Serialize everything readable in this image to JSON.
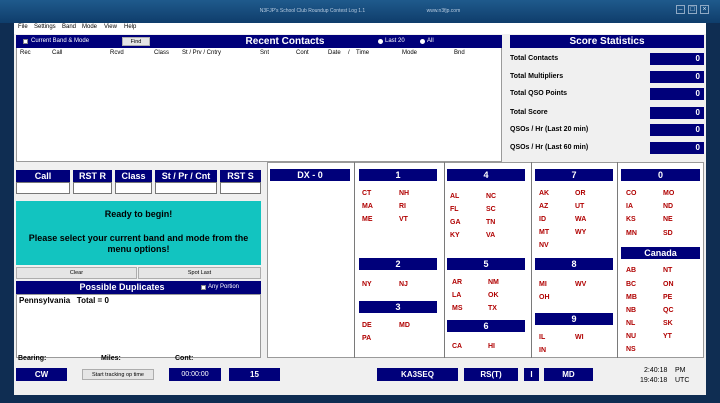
{
  "window": {
    "title": "N3FJP's School Club Roundup Contest Log 1.1",
    "url": "www.n3fjp.com"
  },
  "menu": [
    "File",
    "Settings",
    "Band",
    "Mode",
    "View",
    "Help"
  ],
  "recent": {
    "checkbox_label": "Current Band & Mode",
    "find_label": "Find",
    "title": "Recent Contacts",
    "radio_last": "Last 20",
    "radio_all": "All",
    "columns": [
      "Rec",
      "Call",
      "Rcvd",
      "Class",
      "St / Prv / Cntry",
      "Snt",
      "Cont",
      "Date",
      "/",
      "Time",
      "Mode",
      "Bnd"
    ]
  },
  "stats": {
    "title": "Score Statistics",
    "rows": [
      {
        "label": "Total Contacts",
        "value": "0"
      },
      {
        "label": "Total Multipliers",
        "value": "0"
      },
      {
        "label": "Total QSO Points",
        "value": "0"
      },
      {
        "label": "Total Score",
        "value": "0"
      },
      {
        "label": "QSOs / Hr (Last 20 min)",
        "value": "0"
      },
      {
        "label": "QSOs / Hr (Last 60 min)",
        "value": "0"
      }
    ]
  },
  "entry": {
    "headers": [
      "Call",
      "RST R",
      "Class",
      "St / Pr / Cnt",
      "RST S"
    ]
  },
  "message": {
    "line1": "Ready to begin!",
    "line2": "Please select your current band and mode from the menu options!"
  },
  "buttons": {
    "clear": "Clear",
    "spot_last": "Spot Last"
  },
  "duplicates": {
    "title": "Possible Duplicates",
    "any_portion": "Any Portion",
    "content": "Pennsylvania   Total = 0"
  },
  "dx": {
    "title": "DX - 0"
  },
  "districts": {
    "d1": {
      "label": "1",
      "states": [
        "CT",
        "NH",
        "MA",
        "RI",
        "ME",
        "VT"
      ]
    },
    "d2": {
      "label": "2",
      "states": [
        "NY",
        "NJ"
      ]
    },
    "d3": {
      "label": "3",
      "states": [
        "DE",
        "MD",
        "PA"
      ]
    },
    "d4": {
      "label": "4",
      "states": [
        "AL",
        "NC",
        "FL",
        "SC",
        "GA",
        "TN",
        "KY",
        "VA"
      ]
    },
    "d5": {
      "label": "5",
      "states": [
        "AR",
        "NM",
        "LA",
        "OK",
        "MS",
        "TX"
      ]
    },
    "d6": {
      "label": "6",
      "states": [
        "CA",
        "HI"
      ]
    },
    "d7": {
      "label": "7",
      "states": [
        "AK",
        "OR",
        "AZ",
        "UT",
        "ID",
        "WA",
        "MT",
        "WY",
        "NV"
      ]
    },
    "d8": {
      "label": "8",
      "states": [
        "MI",
        "WV",
        "OH"
      ]
    },
    "d9": {
      "label": "9",
      "states": [
        "IL",
        "WI",
        "IN"
      ]
    },
    "d0": {
      "label": "0",
      "states": [
        "CO",
        "MO",
        "IA",
        "ND",
        "KS",
        "NE",
        "MN",
        "SD"
      ]
    },
    "canada": {
      "label": "Canada",
      "states": [
        "AB",
        "NT",
        "BC",
        "ON",
        "MB",
        "PE",
        "NB",
        "QC",
        "NL",
        "SK",
        "NU",
        "YT",
        "NS"
      ]
    }
  },
  "bottom": {
    "bearing_label": "Bearing:",
    "miles_label": "Miles:",
    "cont_label": "Cont:",
    "bearing_value": "CW",
    "track_button": "Start tracking op time",
    "op_time": "00:00:00",
    "band": "15",
    "callsign": "KA3SEQ",
    "rs": "RS(T)",
    "i": "I",
    "state": "MD",
    "local_time": "2:40:18",
    "local_ampm": "PM",
    "utc_time": "19:40:18",
    "utc_label": "UTC"
  }
}
